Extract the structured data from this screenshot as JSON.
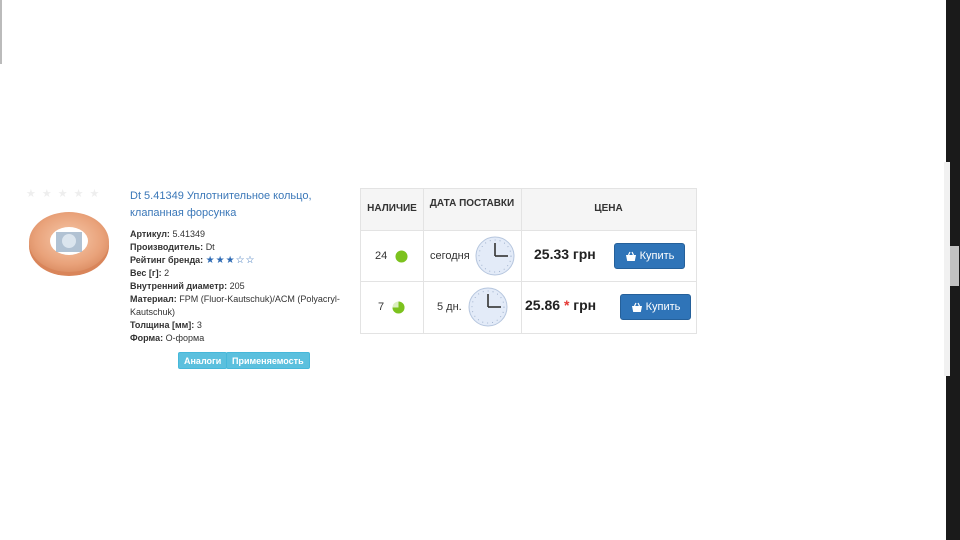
{
  "product": {
    "title": "Dt 5.41349 Уплотнительное кольцо, клапанная форсунка",
    "props": [
      {
        "label": "Артикул:",
        "value": "5.41349"
      },
      {
        "label": "Производитель:",
        "value": "Dt"
      },
      {
        "label": "Рейтинг бренда:",
        "value": "★★★☆☆"
      },
      {
        "label": "Вес [г]:",
        "value": "2"
      },
      {
        "label": "Внутренний диаметр:",
        "value": "205"
      },
      {
        "label": "Материал:",
        "value": "FPM (Fluor-Kautschuk)/ACM (Polyacryl-Kautschuk)"
      },
      {
        "label": "Толщина [мм]:",
        "value": "3"
      },
      {
        "label": "Форма:",
        "value": "O-форма"
      }
    ],
    "brand_rating": 3,
    "buttons": {
      "analogs": "Аналоги",
      "applicability": "Применяемость"
    }
  },
  "offers": {
    "headers": {
      "availability": "НАЛИЧИЕ",
      "delivery_date": "ДАТА ПОСТАВКИ",
      "price": "ЦЕНА"
    },
    "rows": [
      {
        "qty": "24",
        "stock_level": 1.0,
        "delivery": "сегодня",
        "price": "25.33 грн",
        "price_note": "",
        "buy": "Купить"
      },
      {
        "qty": "7",
        "stock_level": 0.75,
        "delivery": "5 дн.",
        "price": "25.86",
        "price_note": "*",
        "currency": "грн",
        "buy": "Купить"
      }
    ]
  },
  "colors": {
    "accent": "#2f74b8",
    "link": "#3a77b8",
    "tag": "#5bc0de",
    "stock_dot": "#7cc21e",
    "price_star": "#e53935"
  }
}
